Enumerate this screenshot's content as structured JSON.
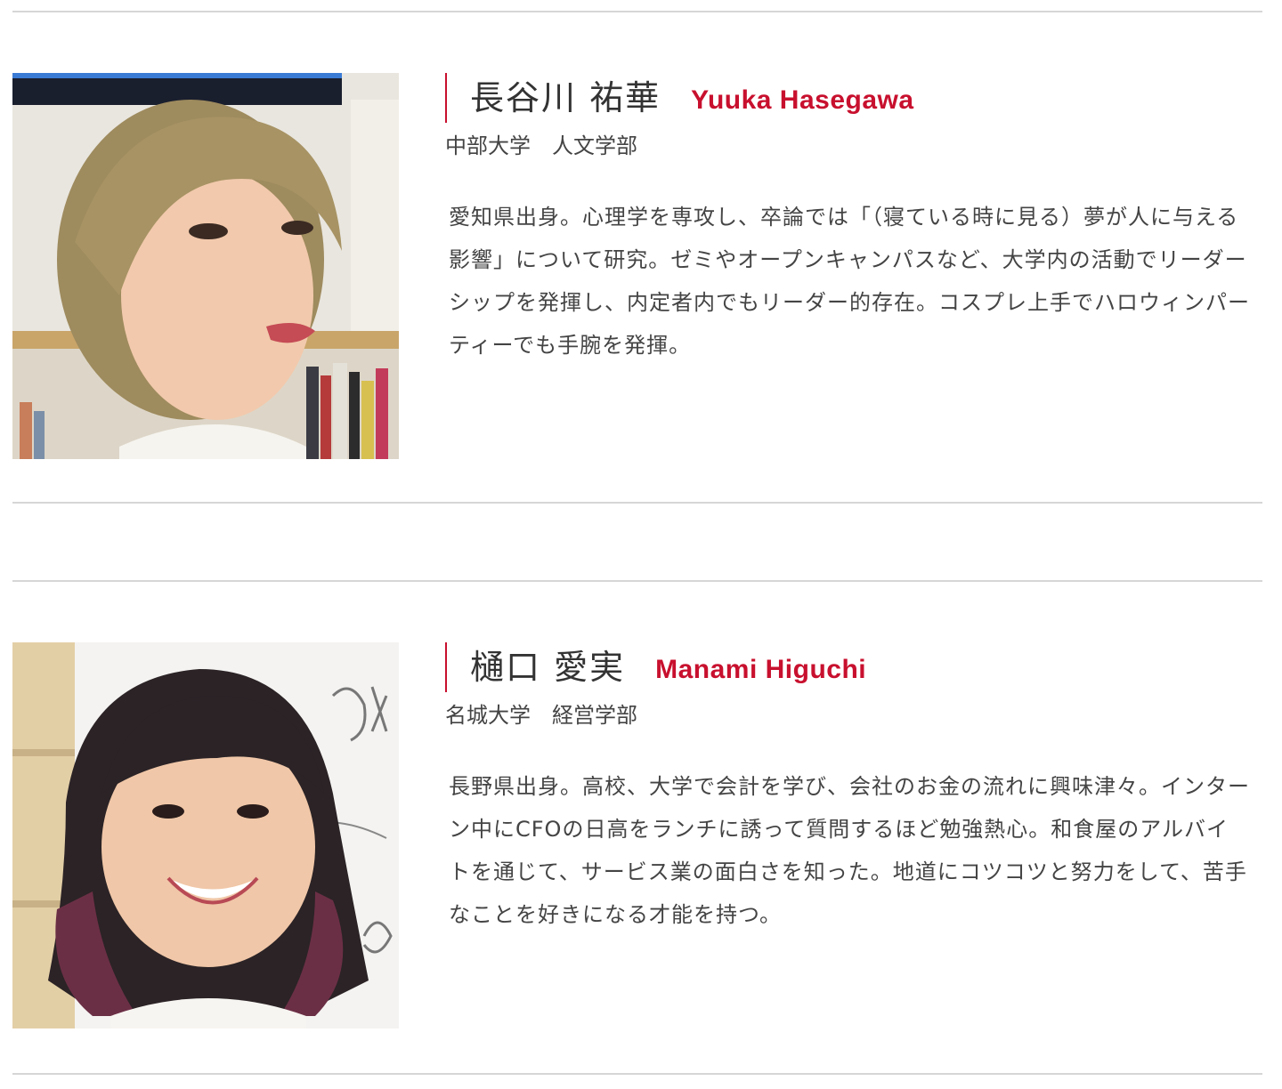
{
  "profiles": [
    {
      "name_jp": "長谷川 祐華",
      "name_en": "Yuuka Hasegawa",
      "school": "中部大学　人文学部",
      "bio": "愛知県出身。心理学を専攻し、卒論では「（寝ている時に見る）夢が人に与える影響」について研究。ゼミやオープンキャンパスなど、大学内の活動でリーダーシップを発揮し、内定者内でもリーダー的存在。コスプレ上手でハロウィンパーティーでも手腕を発揮。"
    },
    {
      "name_jp": "樋口 愛実",
      "name_en": "Manami Higuchi",
      "school": "名城大学　経営学部",
      "bio": "長野県出身。高校、大学で会計を学び、会社のお金の流れに興味津々。インターン中にCFOの日高をランチに誘って質問するほど勉強熱心。和食屋のアルバイトを通じて、サービス業の面白さを知った。地道にコツコツと努力をして、苦手なことを好きになる才能を持つ。"
    }
  ],
  "colors": {
    "accent": "#c8102e",
    "divider": "#d6d6d6",
    "text": "#333333"
  }
}
